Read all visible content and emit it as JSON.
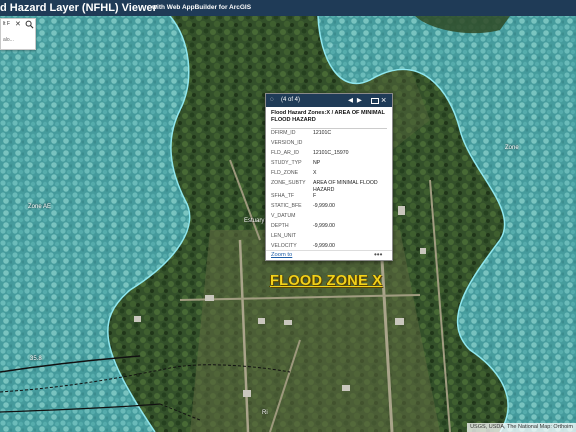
{
  "app": {
    "title": "d Hazard Layer (NFHL) Viewer",
    "subtitle": "with Web AppBuilder for ArcGIS"
  },
  "search": {
    "query": "lt F",
    "placeholder": "alo..."
  },
  "popup": {
    "count": "(4 of 4)",
    "title": "Flood Hazard Zones:X / AREA OF MINIMAL FLOOD HAZARD",
    "fields": [
      {
        "key": "DFIRM_ID",
        "value": "12101C"
      },
      {
        "key": "VERSION_ID",
        "value": ""
      },
      {
        "key": "FLD_AR_ID",
        "value": "12101C_15970"
      },
      {
        "key": "STUDY_TYP",
        "value": "NP"
      },
      {
        "key": "FLD_ZONE",
        "value": "X"
      },
      {
        "key": "ZONE_SUBTY",
        "value": "AREA OF MINIMAL FLOOD HAZARD"
      },
      {
        "key": "SFHA_TF",
        "value": "F"
      },
      {
        "key": "STATIC_BFE",
        "value": "-9,999.00"
      },
      {
        "key": "V_DATUM",
        "value": ""
      },
      {
        "key": "DEPTH",
        "value": "-9,999.00"
      },
      {
        "key": "LEN_UNIT",
        "value": ""
      },
      {
        "key": "VELOCITY",
        "value": "-9,999.00"
      }
    ],
    "zoom_label": "Zoom to",
    "more_label": "•••"
  },
  "map": {
    "zone_label": "FLOOD ZONE X",
    "labels": {
      "zone_ae": "Zone AE",
      "zone_right": "Zone",
      "elev": "35.8",
      "place_a": "Estuary",
      "place_b": "Ri"
    },
    "attribution": "USGS, USDA, The National Map: Orthoim",
    "colors": {
      "flood_overlay": "#54c2cc",
      "flood_boundary": "#8fe7ef",
      "forest": "#2f4a25",
      "clearing": "#6b7049",
      "header": "#1f3b57",
      "zone_label": "#f2d21b"
    }
  }
}
